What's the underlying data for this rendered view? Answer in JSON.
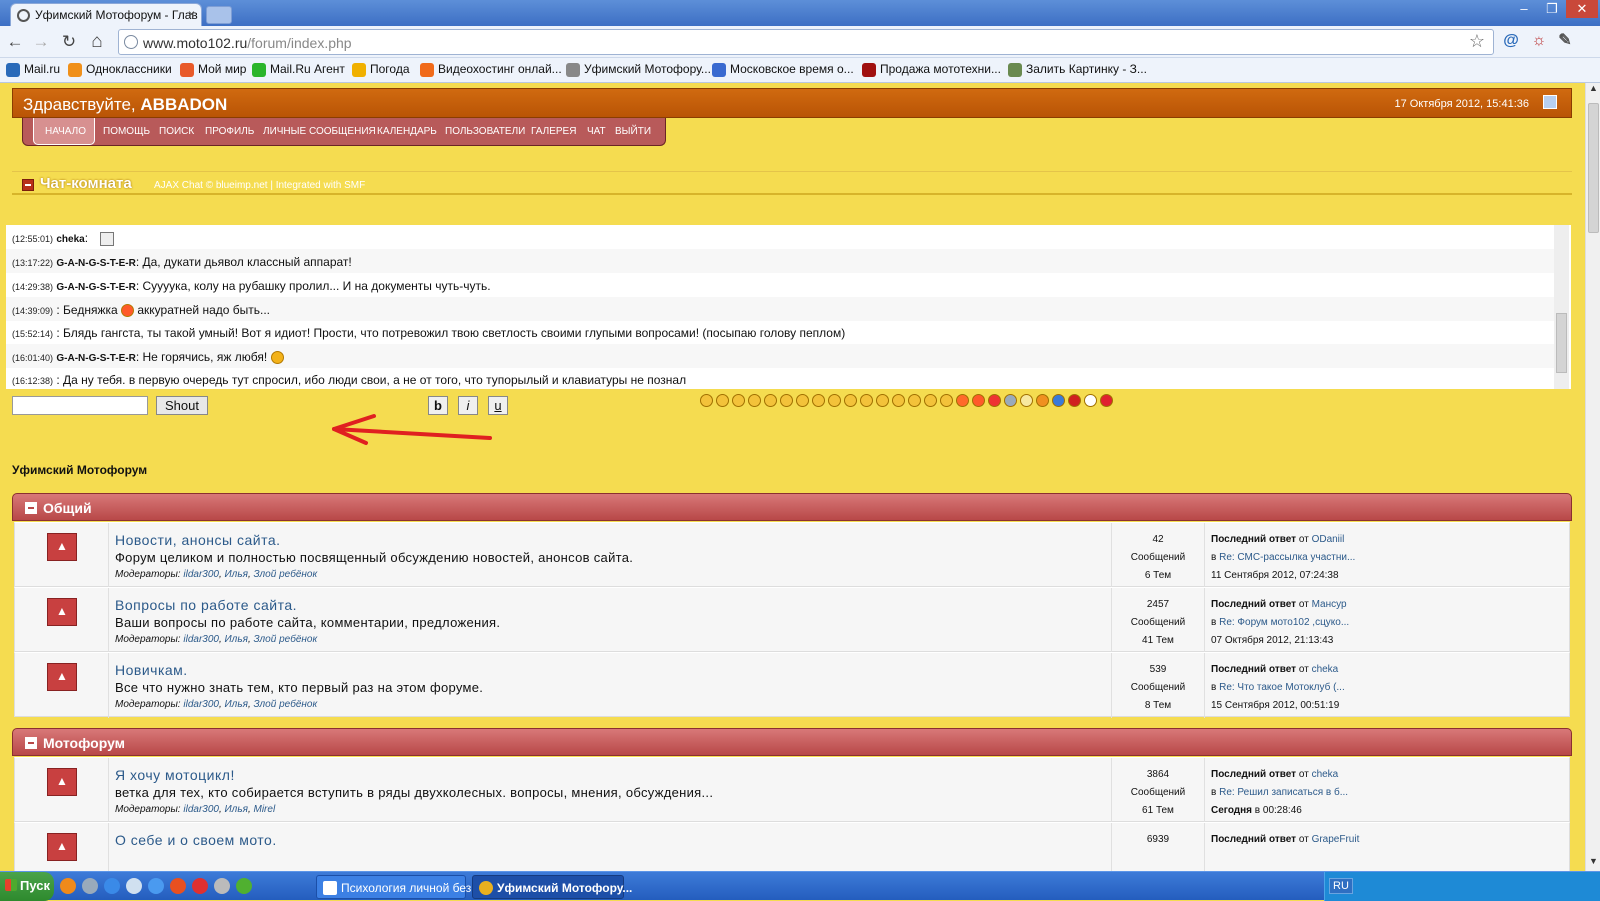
{
  "browser": {
    "tab_title": "Уфимский Мотофорум - Глав",
    "tab_close": "×",
    "url_host": "www.moto102.ru",
    "url_path": "/forum/index.php",
    "window_min": "–",
    "window_max": "❐",
    "window_close": "✕",
    "back": "←",
    "forward": "→",
    "reload": "↻",
    "home": "⌂",
    "star": "☆",
    "bookmarks": [
      {
        "label": "Mail.ru",
        "color": "#2a6ab9"
      },
      {
        "label": "Одноклассники",
        "color": "#f0901a"
      },
      {
        "label": "Мой мир",
        "color": "#e85a2a"
      },
      {
        "label": "Mail.Ru Агент",
        "color": "#2bb52b"
      },
      {
        "label": "Погода",
        "color": "#f0b000"
      },
      {
        "label": "Видеохостинг онлай...",
        "color": "#f06a1a"
      },
      {
        "label": "Уфимский Мотофору...",
        "color": "#888888"
      },
      {
        "label": "Московское время о...",
        "color": "#3a6ad0"
      },
      {
        "label": "Продажа мототехни...",
        "color": "#a01010"
      },
      {
        "label": "Залить Картинку - З...",
        "color": "#6a8a50"
      }
    ]
  },
  "header": {
    "greeting": "Здравствуйте,",
    "username": "ABBADON",
    "datetime": "17 Октября 2012, 15:41:36"
  },
  "menu": [
    "Начало",
    "Помощь",
    "Поиск",
    "Профиль",
    "Личные сообщения",
    "Календарь",
    "Пользователи",
    "Галерея",
    "Чат",
    "Выйти"
  ],
  "chat": {
    "title": "Чат-комната",
    "subtitle": "AJAX Chat © blueimp.net | Integrated with SMF",
    "lines": [
      {
        "time": "(12:55:01)",
        "user": "cheka",
        "text": ":"
      },
      {
        "time": "(13:17:22)",
        "user": "G-A-N-G-S-T-E-R",
        "text": ": Да, дукати дьявол классный аппарат!"
      },
      {
        "time": "(14:29:38)",
        "user": "G-A-N-G-S-T-E-R",
        "text": ": Суууука, колу на рубашку пролил... И на документы чуть-чуть."
      },
      {
        "time": "(14:39:09)",
        "user": "",
        "text": ": Бедняжка",
        "text2": "аккуратней надо быть..."
      },
      {
        "time": "(15:52:14)",
        "user": "",
        "text": ": Блядь гангста, ты такой умный! Вот я идиот! Прости, что потревожил твою светлость своими глупыми вопросами! (посыпаю голову пеплом)"
      },
      {
        "time": "(16:01:40)",
        "user": "G-A-N-G-S-T-E-R",
        "text": ": Не горячись, яж любя!"
      },
      {
        "time": "(16:12:38)",
        "user": "",
        "text": ": Да ну тебя. в первую очередь тут спросил, ибо люди свои, а не от того, что тупорылый и клавиатуры не познал"
      }
    ],
    "input_value": "",
    "shout_label": "Shout",
    "bold": "b",
    "italic": "i",
    "underline": "u"
  },
  "forum": {
    "title": "Уфимский Мотофорум",
    "categories": [
      {
        "name": "Общий",
        "boards": [
          {
            "name": "Новости, анонсы сайта.",
            "desc": "Форум целиком и полностью посвященный обсуждению новостей, анонсов сайта.",
            "mods_label": "Модераторы:",
            "mods": [
              "ildar300",
              "Илья",
              "Злой ребёнок"
            ],
            "posts": "42",
            "posts_label": "Сообщений",
            "topics": "6 Тем",
            "last_label": "Последний ответ",
            "last_by_label": "от",
            "last_user": "ODaniil",
            "last_in_label": "в",
            "last_topic": "Re: СМС-рассылка участни...",
            "last_date": "11 Сентября 2012, 07:24:38"
          },
          {
            "name": "Вопросы по работе сайта.",
            "desc": "Ваши вопросы по работе сайта, комментарии, предложения.",
            "mods_label": "Модераторы:",
            "mods": [
              "ildar300",
              "Илья",
              "Злой ребёнок"
            ],
            "posts": "2457",
            "posts_label": "Сообщений",
            "topics": "41 Тем",
            "last_label": "Последний ответ",
            "last_by_label": "от",
            "last_user": "Мансур",
            "last_in_label": "в",
            "last_topic": "Re: Форум мото102 ,сцуко...",
            "last_date": "07 Октября 2012, 21:13:43"
          },
          {
            "name": "Новичкам.",
            "desc": "Все что нужно знать тем, кто первый раз на этом форуме.",
            "mods_label": "Модераторы:",
            "mods": [
              "ildar300",
              "Илья",
              "Злой ребёнок"
            ],
            "posts": "539",
            "posts_label": "Сообщений",
            "topics": "8 Тем",
            "last_label": "Последний ответ",
            "last_by_label": "от",
            "last_user": "cheka",
            "last_in_label": "в",
            "last_topic": "Re: Что такое Мотоклуб (...",
            "last_date": "15 Сентября 2012, 00:51:19"
          }
        ]
      },
      {
        "name": "Мотофорум",
        "boards": [
          {
            "name": "Я хочу мотоцикл!",
            "desc": "ветка для тех, кто собирается вступить в ряды двухколесных. вопросы, мнения, обсуждения...",
            "mods_label": "Модераторы:",
            "mods": [
              "ildar300",
              "Илья",
              "Mirel"
            ],
            "posts": "3864",
            "posts_label": "Сообщений",
            "topics": "61 Тем",
            "last_label": "Последний ответ",
            "last_by_label": "от",
            "last_user": "cheka",
            "last_in_label": "в",
            "last_topic": "Re: Решил записаться в б...",
            "last_date_bold": "Сегодня",
            "last_date": "в 00:28:46"
          },
          {
            "name": "О себе и о своем мото.",
            "desc": "",
            "mods_label": "",
            "mods": [],
            "posts": "6939",
            "posts_label": "",
            "topics": "",
            "last_label": "Последний ответ",
            "last_by_label": "от",
            "last_user": "GrapeFruit",
            "last_in_label": "",
            "last_topic": "",
            "last_date": ""
          }
        ]
      }
    ]
  },
  "taskbar": {
    "start": "Пуск",
    "tasks": [
      "Психология личной без...",
      "Уфимский Мотофору..."
    ],
    "lang": "RU"
  }
}
